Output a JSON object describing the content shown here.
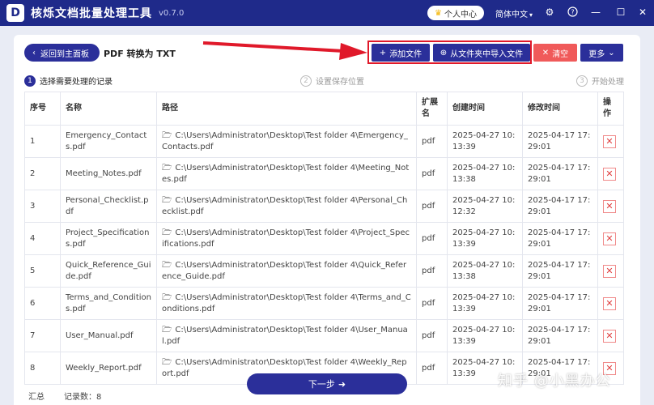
{
  "app": {
    "logo_letter": "D",
    "title": "核烁文档批量处理工具",
    "version": "v0.7.0",
    "user_center": "个人中心",
    "language": "简体中文"
  },
  "toolbar": {
    "back_label": "返回到主面板",
    "page_title": "PDF 转换为 TXT",
    "add_file": "添加文件",
    "import_folder": "从文件夹中导入文件",
    "clear": "清空",
    "more": "更多"
  },
  "steps": [
    {
      "num": "1",
      "label": "选择需要处理的记录"
    },
    {
      "num": "2",
      "label": "设置保存位置"
    },
    {
      "num": "3",
      "label": "开始处理"
    }
  ],
  "table": {
    "headers": {
      "index": "序号",
      "name": "名称",
      "path": "路径",
      "ext": "扩展名",
      "created": "创建时间",
      "modified": "修改时间",
      "action": "操作"
    },
    "rows": [
      {
        "index": "1",
        "name": "Emergency_Contacts.pdf",
        "path": "C:\\Users\\Administrator\\Desktop\\Test folder 4\\Emergency_Contacts.pdf",
        "ext": "pdf",
        "created": "2025-04-27 10:13:39",
        "modified": "2025-04-17 17:29:01"
      },
      {
        "index": "2",
        "name": "Meeting_Notes.pdf",
        "path": "C:\\Users\\Administrator\\Desktop\\Test folder 4\\Meeting_Notes.pdf",
        "ext": "pdf",
        "created": "2025-04-27 10:13:38",
        "modified": "2025-04-17 17:29:01"
      },
      {
        "index": "3",
        "name": "Personal_Checklist.pdf",
        "path": "C:\\Users\\Administrator\\Desktop\\Test folder 4\\Personal_Checklist.pdf",
        "ext": "pdf",
        "created": "2025-04-27 10:12:32",
        "modified": "2025-04-17 17:29:01"
      },
      {
        "index": "4",
        "name": "Project_Specifications.pdf",
        "path": "C:\\Users\\Administrator\\Desktop\\Test folder 4\\Project_Specifications.pdf",
        "ext": "pdf",
        "created": "2025-04-27 10:13:39",
        "modified": "2025-04-17 17:29:01"
      },
      {
        "index": "5",
        "name": "Quick_Reference_Guide.pdf",
        "path": "C:\\Users\\Administrator\\Desktop\\Test folder 4\\Quick_Reference_Guide.pdf",
        "ext": "pdf",
        "created": "2025-04-27 10:13:38",
        "modified": "2025-04-17 17:29:01"
      },
      {
        "index": "6",
        "name": "Terms_and_Conditions.pdf",
        "path": "C:\\Users\\Administrator\\Desktop\\Test folder 4\\Terms_and_Conditions.pdf",
        "ext": "pdf",
        "created": "2025-04-27 10:13:39",
        "modified": "2025-04-17 17:29:01"
      },
      {
        "index": "7",
        "name": "User_Manual.pdf",
        "path": "C:\\Users\\Administrator\\Desktop\\Test folder 4\\User_Manual.pdf",
        "ext": "pdf",
        "created": "2025-04-27 10:13:39",
        "modified": "2025-04-17 17:29:01"
      },
      {
        "index": "8",
        "name": "Weekly_Report.pdf",
        "path": "C:\\Users\\Administrator\\Desktop\\Test folder 4\\Weekly_Report.pdf",
        "ext": "pdf",
        "created": "2025-04-27 10:13:39",
        "modified": "2025-04-17 17:29:01"
      }
    ]
  },
  "footer": {
    "summary": "汇总",
    "count": "记录数：8",
    "next": "下一步"
  },
  "watermark": "知乎 @小黑办公",
  "colors": {
    "primary": "#2b2f9a",
    "titlebar": "#1f2a8a",
    "danger": "#f05a5a",
    "highlight": "#e0192a"
  }
}
